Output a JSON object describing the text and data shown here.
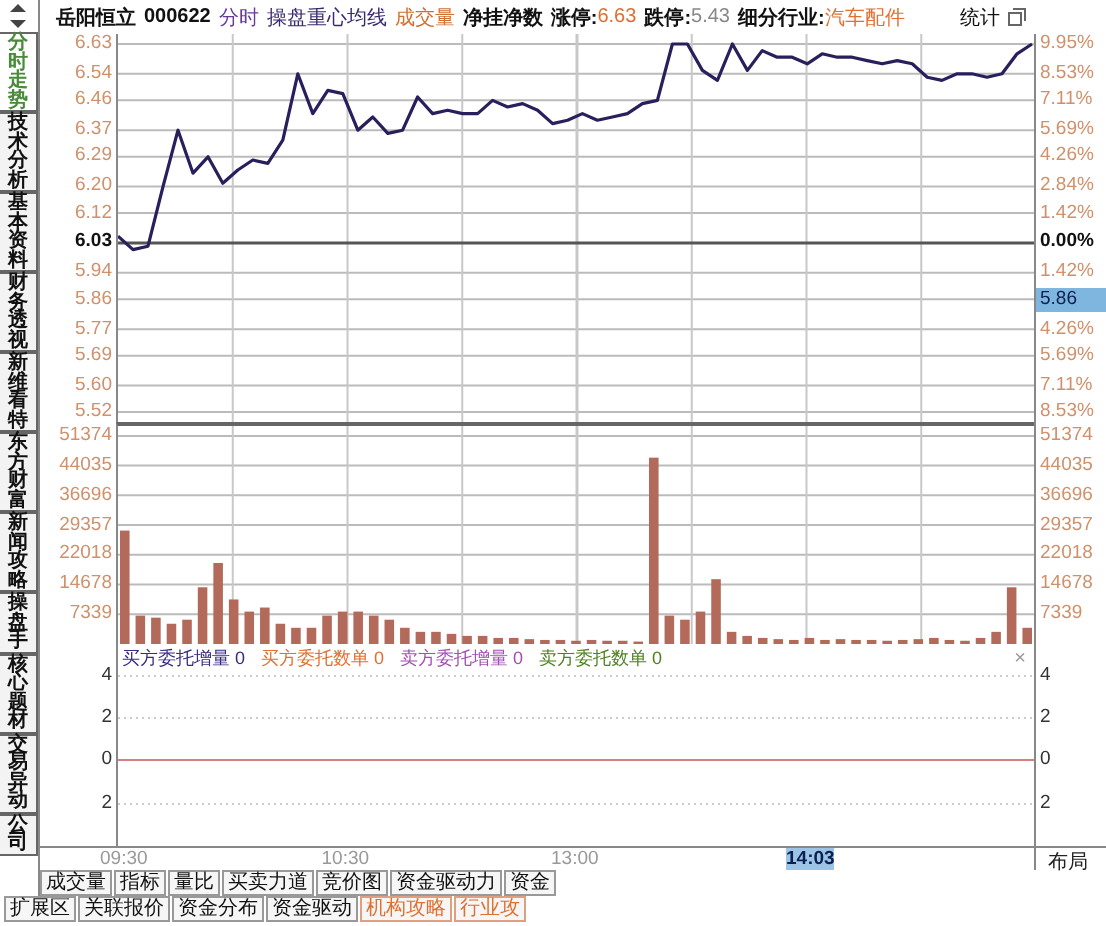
{
  "sidebar": {
    "tabs": [
      {
        "label": "分时走势",
        "selected": true
      },
      {
        "label": "技术分析",
        "selected": false
      },
      {
        "label": "基本资料",
        "selected": false
      },
      {
        "label": "财务透视",
        "selected": false
      },
      {
        "label": "新维看特",
        "selected": false
      },
      {
        "label": "东方财富",
        "selected": false
      },
      {
        "label": "新闻攻略",
        "selected": false
      },
      {
        "label": "操盘手",
        "selected": false
      },
      {
        "label": "核心题材",
        "selected": false
      },
      {
        "label": "交易异动",
        "selected": false
      },
      {
        "label": "公司",
        "selected": false
      }
    ]
  },
  "header": {
    "items": [
      {
        "text": "岳阳恒立",
        "kind": "name"
      },
      {
        "text": "000622",
        "kind": "name"
      },
      {
        "text": "分时",
        "kind": "period"
      },
      {
        "text": "操盘重心均线",
        "kind": "indicator"
      },
      {
        "text": "成交量",
        "kind": "volume"
      },
      {
        "text": "净挂净数",
        "kind": "name"
      }
    ],
    "fields": [
      {
        "label": "涨停:",
        "value": "6.63",
        "kind": "up"
      },
      {
        "label": "跌停:",
        "value": "5.43",
        "kind": "down"
      },
      {
        "label": "细分行业:",
        "value": "汽车配件",
        "kind": "up"
      }
    ],
    "stats": "统计"
  },
  "price_chart": {
    "chart_data": {
      "type": "line",
      "grid": true,
      "ref_lines": [
        {
          "axis": "y",
          "value": 6.03
        }
      ],
      "ylim": [
        5.49,
        6.66
      ],
      "yticks": [
        {
          "value": 6.63,
          "label": "6.63"
        },
        {
          "value": 6.54,
          "label": "6.54"
        },
        {
          "value": 6.46,
          "label": "6.46"
        },
        {
          "value": 6.37,
          "label": "6.37"
        },
        {
          "value": 6.29,
          "label": "6.29"
        },
        {
          "value": 6.2,
          "label": "6.20"
        },
        {
          "value": 6.12,
          "label": "6.12"
        },
        {
          "value": 6.03,
          "label": "6.03"
        },
        {
          "value": 5.94,
          "label": "5.94"
        },
        {
          "value": 5.86,
          "label": "5.86"
        },
        {
          "value": 5.77,
          "label": "5.77"
        },
        {
          "value": 5.69,
          "label": "5.69"
        },
        {
          "value": 5.6,
          "label": "5.60"
        },
        {
          "value": 5.52,
          "label": "5.52"
        }
      ],
      "series": [
        {
          "color": "#2a1f5c",
          "values": [
            6.05,
            6.01,
            6.02,
            6.2,
            6.37,
            6.24,
            6.29,
            6.21,
            6.25,
            6.28,
            6.27,
            6.34,
            6.54,
            6.42,
            6.49,
            6.48,
            6.37,
            6.41,
            6.36,
            6.37,
            6.47,
            6.42,
            6.43,
            6.42,
            6.42,
            6.46,
            6.44,
            6.45,
            6.43,
            6.39,
            6.4,
            6.42,
            6.4,
            6.41,
            6.42,
            6.45,
            6.46,
            6.63,
            6.63,
            6.55,
            6.52,
            6.63,
            6.55,
            6.61,
            6.59,
            6.59,
            6.57,
            6.6,
            6.59,
            6.59,
            6.58,
            6.57,
            6.58,
            6.57,
            6.53,
            6.52,
            6.54,
            6.54,
            6.53,
            6.54,
            6.6,
            6.63
          ]
        }
      ]
    },
    "right_axis": [
      {
        "kind": "tick",
        "label": "9.95%"
      },
      {
        "kind": "tick",
        "label": "8.53%"
      },
      {
        "kind": "tick",
        "label": "7.11%"
      },
      {
        "kind": "tick",
        "label": "5.69%"
      },
      {
        "kind": "tick",
        "label": "4.26%"
      },
      {
        "kind": "tick",
        "label": "2.84%"
      },
      {
        "kind": "tick",
        "label": "1.42%"
      },
      {
        "kind": "base",
        "label": "0.00%"
      },
      {
        "kind": "tick",
        "label": "1.42%"
      },
      {
        "kind": "cursor",
        "label": "5.86"
      },
      {
        "kind": "tick",
        "label": "4.26%"
      },
      {
        "kind": "tick",
        "label": "5.69%"
      },
      {
        "kind": "tick",
        "label": "7.11%"
      },
      {
        "kind": "tick",
        "label": "8.53%"
      }
    ]
  },
  "volume_chart": {
    "chart_data": {
      "type": "bar",
      "grid": true,
      "ylim": [
        0,
        54800
      ],
      "yticks": [
        {
          "value": 51374,
          "label": "51374"
        },
        {
          "value": 44035,
          "label": "44035"
        },
        {
          "value": 36696,
          "label": "36696"
        },
        {
          "value": 29357,
          "label": "29357"
        },
        {
          "value": 22018,
          "label": "22018"
        },
        {
          "value": 14678,
          "label": "14678"
        },
        {
          "value": 7339,
          "label": "7339"
        }
      ],
      "series": [
        {
          "color": "#b46a5a",
          "values": [
            28000,
            7000,
            6500,
            5000,
            6000,
            14000,
            20000,
            11000,
            8000,
            9000,
            5000,
            4000,
            4000,
            7000,
            8000,
            8000,
            7000,
            6000,
            4000,
            3000,
            3000,
            2500,
            2000,
            2000,
            1500,
            1500,
            1200,
            1000,
            1000,
            800,
            1000,
            800,
            800,
            600,
            46000,
            7000,
            6000,
            8000,
            16000,
            3000,
            2000,
            1500,
            1200,
            1000,
            1500,
            1000,
            1200,
            1000,
            1000,
            800,
            1000,
            1200,
            1500,
            1000,
            800,
            1500,
            3000,
            14000,
            4000
          ]
        }
      ]
    }
  },
  "indicator": {
    "legend": [
      {
        "text": "买方委托增量 0",
        "color": "#3a2a80"
      },
      {
        "text": "买方委托数单 0",
        "color": "#e07030"
      },
      {
        "text": "卖方委托增量 0",
        "color": "#a050b0"
      },
      {
        "text": "卖方委托数单 0",
        "color": "#508020"
      }
    ],
    "close": "×",
    "axis": [
      "4",
      "2",
      "0",
      "2"
    ],
    "right_axis": [
      "4",
      "2",
      "0",
      "2"
    ]
  },
  "time_axis": {
    "labels": [
      "09:30",
      "10:30",
      "13:00"
    ],
    "cursor": "14:03",
    "layout": "布局"
  },
  "bottom_tabs": [
    [
      {
        "label": "成交量",
        "kind": "plain"
      },
      {
        "label": "指标",
        "kind": "plain"
      },
      {
        "label": "量比",
        "kind": "plain"
      },
      {
        "label": "买卖力道",
        "kind": "plain"
      },
      {
        "label": "竞价图",
        "kind": "plain"
      },
      {
        "label": "资金驱动力",
        "kind": "plain"
      },
      {
        "label": "资金",
        "kind": "plain"
      }
    ],
    [
      {
        "label": "扩展区",
        "kind": "plain"
      },
      {
        "label": "关联报价",
        "kind": "plain"
      },
      {
        "label": "资金分布",
        "kind": "plain"
      },
      {
        "label": "资金驱动",
        "kind": "plain"
      },
      {
        "label": "机构攻略",
        "kind": "featured"
      },
      {
        "label": "行业攻",
        "kind": "featured"
      }
    ]
  ]
}
